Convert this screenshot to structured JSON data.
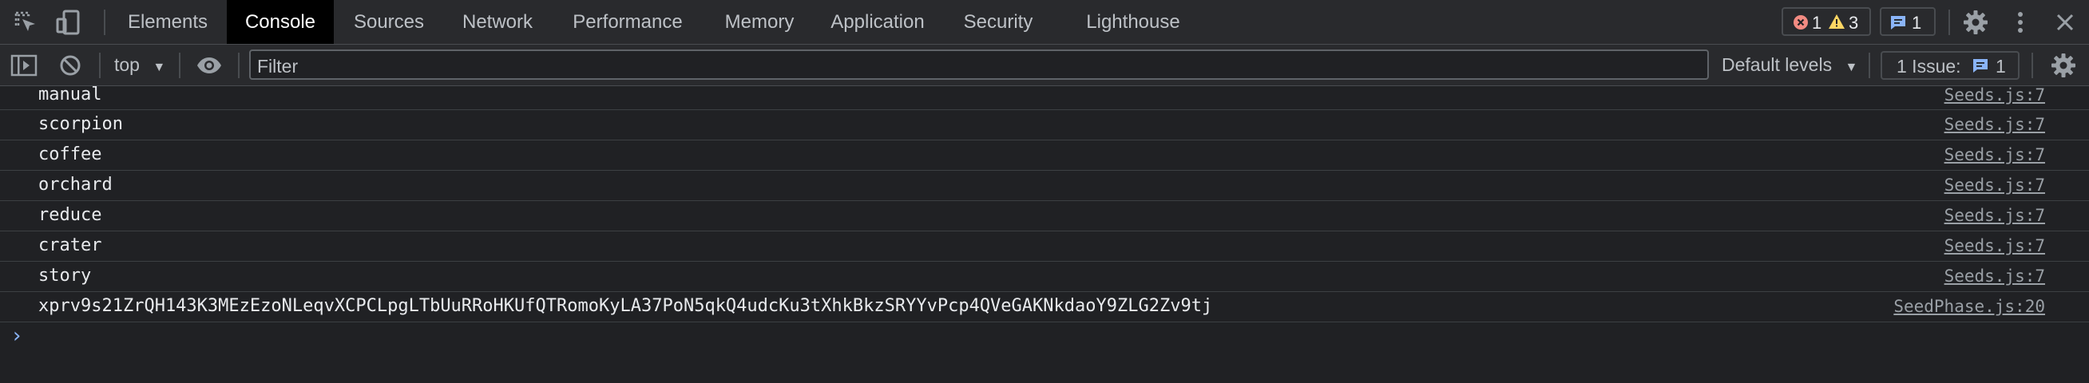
{
  "tabs": [
    {
      "label": "Elements",
      "active": false
    },
    {
      "label": "Console",
      "active": true
    },
    {
      "label": "Sources",
      "active": false
    },
    {
      "label": "Network",
      "active": false
    },
    {
      "label": "Performance",
      "active": false
    },
    {
      "label": "Memory",
      "active": false
    },
    {
      "label": "Application",
      "active": false
    },
    {
      "label": "Security",
      "active": false
    },
    {
      "label": "Lighthouse",
      "active": false
    }
  ],
  "counters": {
    "errors": "1",
    "warnings": "3",
    "messages": "1"
  },
  "toolbar": {
    "context": "top",
    "filter_placeholder": "Filter",
    "levels": "Default levels",
    "issues_label": "1 Issue:",
    "issues_count": "1"
  },
  "logs": [
    {
      "message": "manual",
      "source": "Seeds.js:7"
    },
    {
      "message": "scorpion",
      "source": "Seeds.js:7"
    },
    {
      "message": "coffee",
      "source": "Seeds.js:7"
    },
    {
      "message": "orchard",
      "source": "Seeds.js:7"
    },
    {
      "message": "reduce",
      "source": "Seeds.js:7"
    },
    {
      "message": "crater",
      "source": "Seeds.js:7"
    },
    {
      "message": "story",
      "source": "Seeds.js:7"
    },
    {
      "message": "xprv9s21ZrQH143K3MEzEzoNLeqvXCPCLpgLTbUuRRoHKUfQTRomoKyLA37PoN5qkQ4udcKu3tXhkBkzSRYYvPcp4QVeGAKNkdaoY9ZLG2Zv9tj",
      "source": "SeedPhase.js:20"
    }
  ],
  "colors": {
    "background": "#202124",
    "toolbar": "#292a2d",
    "active_tab": "#000000",
    "error": "#f28b82",
    "warning": "#fdd663",
    "info": "#8ab4f8"
  },
  "icons": [
    "inspect-icon",
    "device-toggle-icon",
    "sidebar-toggle-icon",
    "clear-console-icon",
    "eye-icon",
    "error-icon",
    "warning-icon",
    "message-icon",
    "settings-icon",
    "more-icon",
    "close-icon",
    "prompt-chevron-icon"
  ]
}
